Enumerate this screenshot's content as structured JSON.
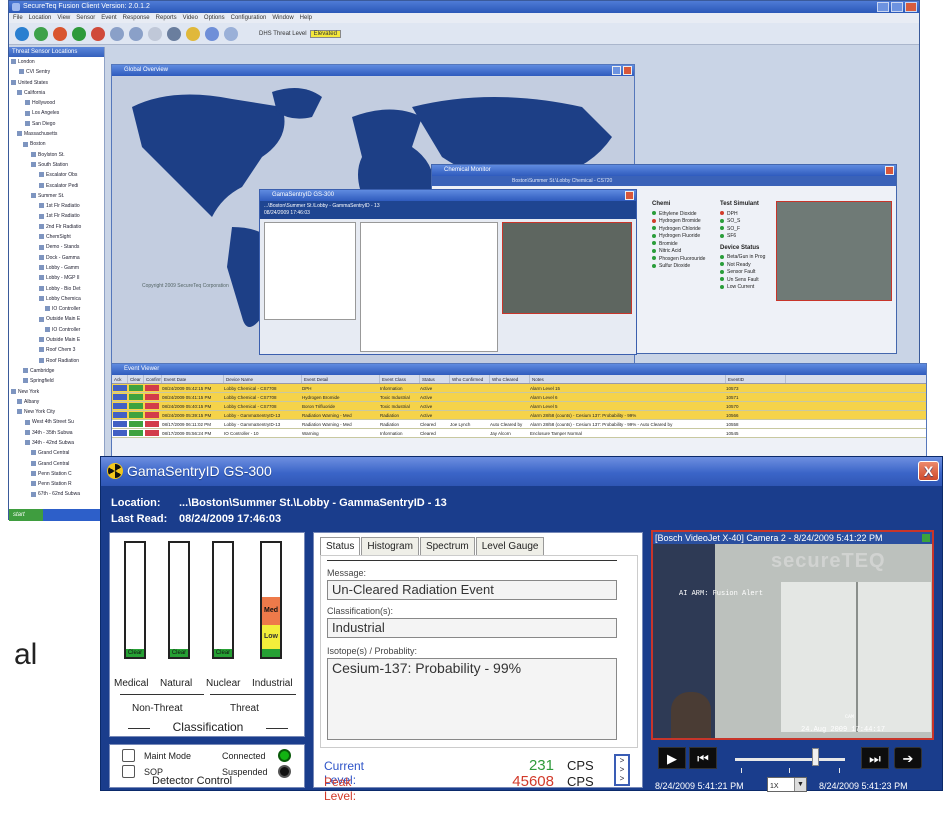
{
  "app": {
    "title": "SecureTeq Fusion Client Version: 2.0.1.2",
    "menu": [
      "File",
      "Location",
      "View",
      "Sensor",
      "Event",
      "Response",
      "Reports",
      "Video",
      "Options",
      "Configuration",
      "Window",
      "Help"
    ],
    "threat_level_label": "DHS Threat Level",
    "threat_level_value": "Elevated"
  },
  "tree": {
    "header": "Threat Sensor Locations",
    "items": [
      "London",
      "CVI Sentry",
      "United States",
      "California",
      "Hollywood",
      "Los Angeles",
      "San Diego",
      "Massachusetts",
      "Boston",
      "Boylston St.",
      "South Station",
      "Escalator Obs",
      "Escalator Pedi",
      "Summer St.",
      "1st Flr Radiatio",
      "1st Flr Radiatio",
      "2nd Flr Radiatio",
      "ChemSight",
      "Demo - Stands",
      "Dock - Gamma",
      "Lobby - Gamm",
      "Lobby - MGP II",
      "Lobby - Bio Det",
      "Lobby Chemica",
      "IO Controller",
      "Outside Main E",
      "IO Controller",
      "Outside Main E",
      "Roof Chem 3",
      "Roof Radiation",
      "Cambridge",
      "Springfield",
      "New York",
      "Albany",
      "New York City",
      "West 4th Street Su",
      "34th - 35th Subwa",
      "34th - 42nd Subwa",
      "Grand Central",
      "Grand Central",
      "Penn Station C",
      "Penn Station R",
      "67th - 62nd Subwa"
    ],
    "start": "start"
  },
  "map_window": {
    "title": "Global Overview",
    "copyright": "Copyright 2009 SecureTeq Corporation"
  },
  "chem_window": {
    "title": "Chemical Monitor",
    "subtitle": "Boston\\Summer St.\\Lobby Chemical - CS720",
    "col1_title": "Chemi",
    "col1": [
      "Ethylene Dioxide",
      "Hydrogen Bromide",
      "Hydrogen Chloride",
      "Hydrogen Fluoride",
      "Bromide",
      "Nitric Acid",
      "Phosgen Fluorouride",
      "Sulfur Dioxide"
    ],
    "col2_title": "Test Simulant",
    "col2": [
      "DPH",
      "SO_S",
      "SO_F",
      "SF6"
    ],
    "col3_title": "Device Status",
    "col3": [
      "Beta/Gun in Prog",
      "Not Ready",
      "Sensor Fault",
      "Un Sens Fault",
      "Low Current"
    ]
  },
  "mini_window": {
    "title": "GamaSentryID GS-300",
    "location": "...\\Boston\\Summer St.\\Lobby - GammaSentryID - 13",
    "last_read": "08/24/2009 17:46:03"
  },
  "events_window": {
    "title": "Event Viewer",
    "columns": [
      "Ack",
      "Clear",
      "Confirm",
      "Event Date",
      "Device Name",
      "Event Detail",
      "Event Class",
      "Status",
      "Who Confirmed",
      "Who Cleared",
      "Notes",
      "EventID"
    ],
    "rows": [
      {
        "date": "08/24/2009 05:42:15 PM",
        "device": "Lobby Chemical - CS7708",
        "detail": "DPH",
        "cls": "Information",
        "status": "Active",
        "who_conf": "",
        "who_clear": "",
        "notes": "Alarm Level 15",
        "id": "10573",
        "highlight": true
      },
      {
        "date": "08/24/2009 05:41:15 PM",
        "device": "Lobby Chemical - CS7708",
        "detail": "Hydrogen Bromide",
        "cls": "Toxic Industrial",
        "status": "Active",
        "who_conf": "",
        "who_clear": "",
        "notes": "Alarm Level 6",
        "id": "10571",
        "highlight": true
      },
      {
        "date": "08/24/2009 05:40:15 PM",
        "device": "Lobby Chemical - CS7708",
        "detail": "Boron Trifluoride",
        "cls": "Toxic Industrial",
        "status": "Active",
        "who_conf": "",
        "who_clear": "",
        "notes": "Alarm Level 5",
        "id": "10570",
        "highlight": true
      },
      {
        "date": "08/24/2009 05:39:15 PM",
        "device": "Lobby - GammaSentryID-13",
        "detail": "Radiation Warning - Med",
        "cls": "Radiation",
        "status": "Active",
        "who_conf": "",
        "who_clear": "",
        "notes": "Alarm 28/58 (counts) - Cesium 137: Probability - 99%",
        "id": "10566",
        "highlight": true
      },
      {
        "date": "08/17/2009 06:11:02 PM",
        "device": "Lobby - GammaSentryID-13",
        "detail": "Radiation Warning - Med",
        "cls": "Radiation",
        "status": "Cleared",
        "who_conf": "Joe Lynch",
        "who_clear": "Auto Cleared by",
        "notes": "Alarm 28/58 (counts) - Cesium 137: Probability - 99% - Auto Cleared by",
        "id": "10558",
        "highlight": false
      },
      {
        "date": "08/17/2009 05:56:24 PM",
        "device": "IO Controller - 10",
        "detail": "Warning",
        "cls": "Information",
        "status": "Cleared",
        "who_conf": "",
        "who_clear": "Jay Alcorn",
        "notes": "Enclosure Tamper Normal",
        "id": "10545",
        "highlight": false
      }
    ]
  },
  "partial_text": "al",
  "detector": {
    "title": "GamaSentryID GS-300",
    "close": "X",
    "location_label": "Location:",
    "location_value": "...\\Boston\\Summer St.\\Lobby - GammaSentryID - 13",
    "last_read_label": "Last Read:",
    "last_read_value": "08/24/2009 17:46:03",
    "bars": [
      {
        "name": "Medical",
        "level": "Clear"
      },
      {
        "name": "Natural",
        "level": "Clear"
      },
      {
        "name": "Nuclear",
        "level": "Clear"
      },
      {
        "name": "Industrial",
        "level": "Med"
      }
    ],
    "level_labels": {
      "clear": "Clear",
      "low": "Low",
      "med": "Med"
    },
    "non_threat_label": "Non-Threat",
    "threat_label": "Threat",
    "classification_title": "Classification",
    "maint_mode": "Maint Mode",
    "sop": "SOP",
    "connected": "Connected",
    "suspended": "Suspended",
    "detector_control": "Detector Control",
    "tabs": [
      "Status",
      "Histogram",
      "Spectrum",
      "Level Gauge"
    ],
    "active_tab": "Status",
    "message_label": "Message:",
    "message_value": "Un-Cleared Radiation Event",
    "classification_label": "Classification(s):",
    "classification_value": "Industrial",
    "isotope_label": "Isotope(s) / Probablity:",
    "isotope_value": "Cesium-137: Probability - 99%",
    "current_level_label": "Current Level:",
    "current_level_value": "231",
    "peak_level_label": "Peak Level:",
    "peak_level_value": "45608",
    "unit": "CPS",
    "more_arrows": ">\n>\n>",
    "video_caption": "[Bosch VideoJet X-40] Camera 2 - 8/24/2009 5:41:22 PM",
    "video_watermark": "secureTEQ",
    "video_osd_alert": "AI ARM: Fusion Alert",
    "video_osd_cam": "CAM",
    "video_osd_time": "24.Aug 2009 17:44:17",
    "play_icon": "▶",
    "rewind_icon": "⏮",
    "forward_icon": "⏭",
    "next_icon": "➔",
    "video_start_time": "8/24/2009 5:41:21 PM",
    "video_end_time": "8/24/2009 5:41:23 PM",
    "speed": "1X",
    "speed_arrow": "▼",
    "colors": {
      "titlebar": "#3b65c8",
      "frame": "#1a3d8c",
      "current_level": "#2e9a3a",
      "peak_level": "#d23a2a",
      "connected": "#12b312",
      "bar_clear": "#26a034",
      "bar_low": "#f3ee3b",
      "bar_med": "#ee7a4a"
    }
  }
}
